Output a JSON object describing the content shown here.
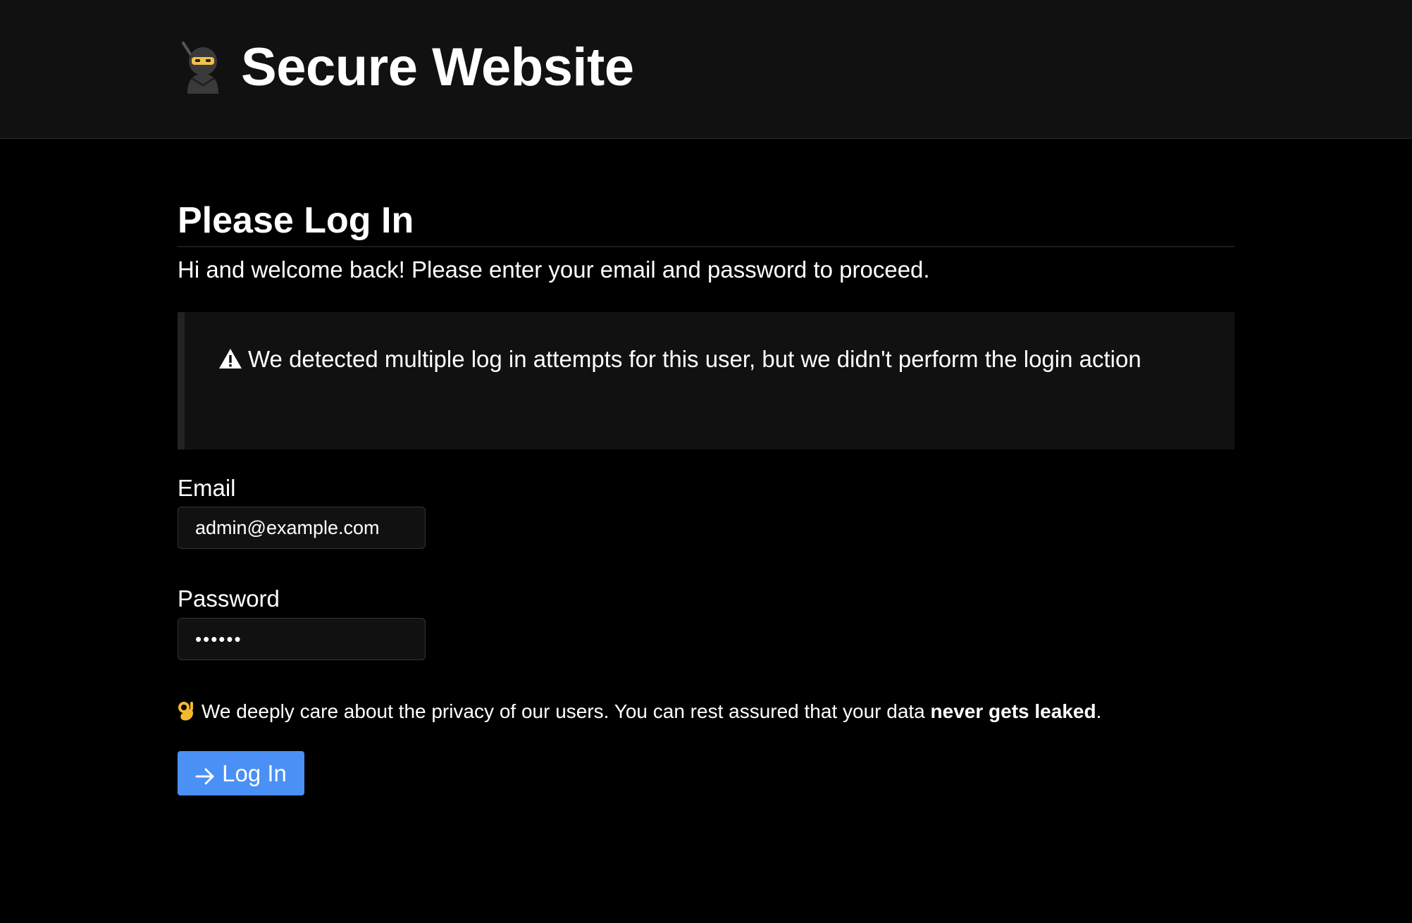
{
  "header": {
    "site_title": "Secure Website",
    "logo_icon": "ninja-icon"
  },
  "main": {
    "page_title": "Please Log In",
    "welcome_text": "Hi and welcome back! Please enter your email and password to proceed.",
    "alert": {
      "icon": "warning-icon",
      "message": "We detected multiple log in attempts for this user, but we didn't perform the login action"
    },
    "email": {
      "label": "Email",
      "value": "admin@example.com"
    },
    "password": {
      "label": "Password",
      "value": "••••••"
    },
    "privacy": {
      "icon": "ok-hand-icon",
      "text": "We deeply care about the privacy of our users. You can rest assured that your data ",
      "emphasis": "never gets leaked",
      "suffix": "."
    },
    "login_button": {
      "icon": "arrow-right-icon",
      "label": "Log In"
    }
  },
  "colors": {
    "background": "#000000",
    "header_background": "#111111",
    "accent": "#4a90f5"
  }
}
